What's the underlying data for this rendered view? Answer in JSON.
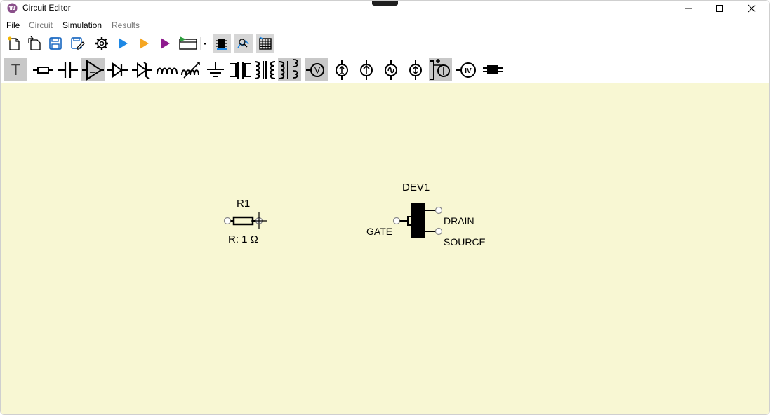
{
  "window": {
    "title": "Circuit Editor"
  },
  "menu": {
    "items": [
      "File",
      "Circuit",
      "Simulation",
      "Results"
    ]
  },
  "toolbar1": {
    "buttons": [
      "new-file-icon",
      "open-file-icon",
      "save-icon",
      "save-as-icon",
      "settings-gear-icon",
      "run-blue-icon",
      "run-orange-icon",
      "run-purple-icon",
      "display-dropdown-icon",
      "chip-icon",
      "zoom-fit-icon",
      "table-icon"
    ]
  },
  "toolbar2": {
    "text_tool_label": "T",
    "tools": [
      "text-tool",
      "resistor",
      "capacitor",
      "opamp",
      "diode",
      "zener-diode",
      "inductor",
      "variable-inductor",
      "ground",
      "switch",
      "transformer",
      "transformer-coupled",
      "voltmeter",
      "current-source",
      "voltage-source",
      "ac-source",
      "dependent-source",
      "variable-source",
      "iv-probe",
      "generic-device"
    ],
    "voltmeter_label": "V",
    "iv_label": "IV"
  },
  "canvas": {
    "background": "#f8f7d3",
    "r1": {
      "name": "R1",
      "value_label": "R: 1 Ω"
    },
    "dev1": {
      "name": "DEV1",
      "pins": {
        "gate": "GATE",
        "drain": "DRAIN",
        "source": "SOURCE"
      }
    }
  }
}
